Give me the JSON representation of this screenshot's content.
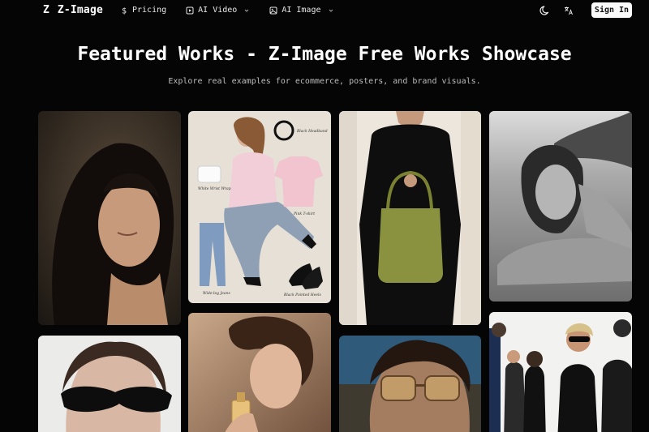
{
  "header": {
    "logo_mark": "Z",
    "brand": "Z-Image",
    "nav": [
      {
        "label": "Pricing",
        "icon": "dollar-icon",
        "dropdown": false
      },
      {
        "label": "AI Video",
        "icon": "video-icon",
        "dropdown": true
      },
      {
        "label": "AI Image",
        "icon": "image-icon",
        "dropdown": true
      }
    ],
    "theme_icon": "moon-icon",
    "language_icon": "translate-icon",
    "sign_in_label": "Sign In"
  },
  "hero": {
    "title": "Featured Works - Z-Image Free Works Showcase",
    "subtitle": "Explore real examples for ecommerce, posters, and brand visuals."
  },
  "gallery": {
    "fashion_labels": [
      "Black Headband",
      "White Wrist Wrap",
      "Pink T-shirt",
      "Wide-leg Jeans",
      "Black Pointed Heels"
    ]
  },
  "colors": {
    "background": "#050505",
    "button_bg": "#fafafa",
    "text_muted": "#bdbdbd"
  }
}
